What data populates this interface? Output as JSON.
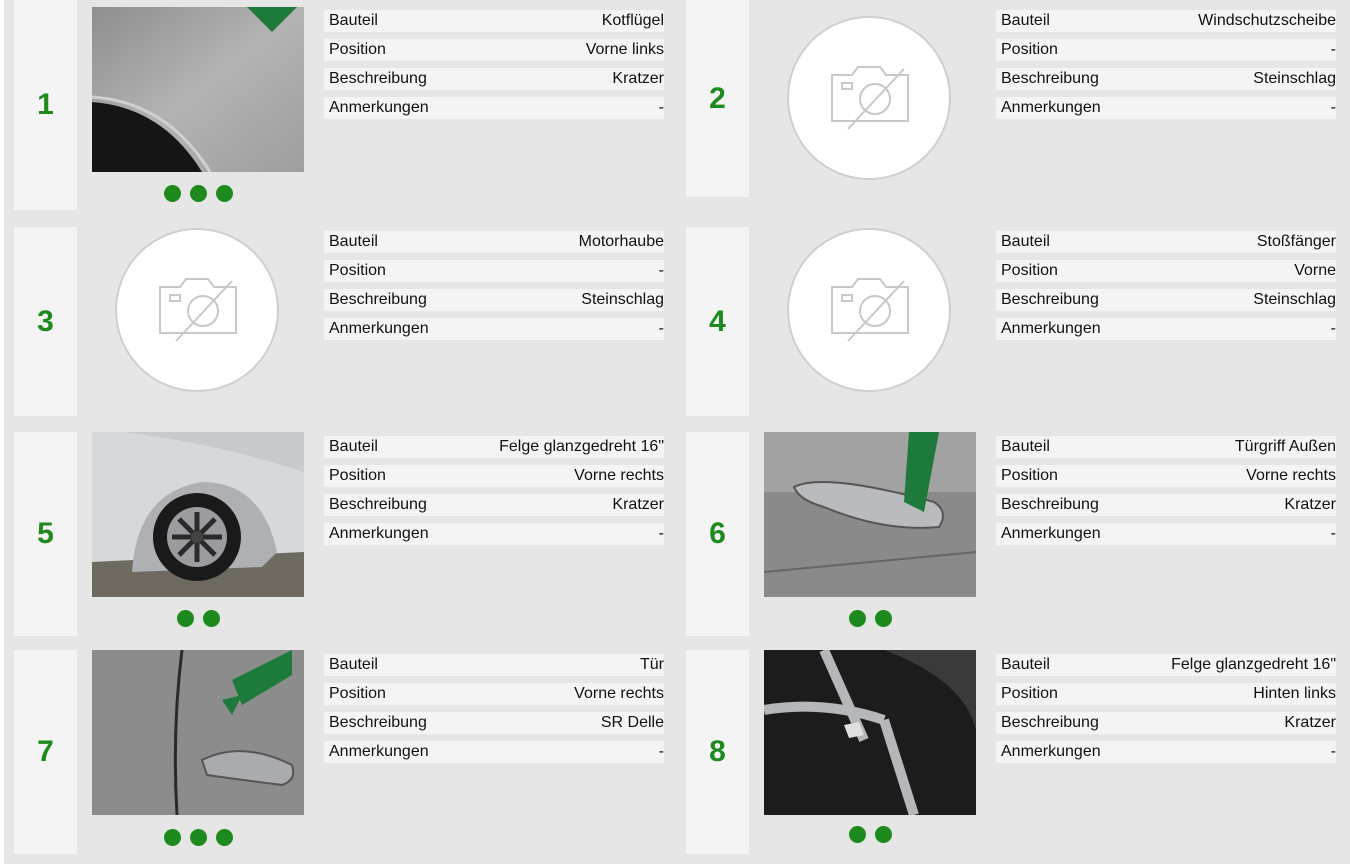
{
  "labels": {
    "component": "Bauteil",
    "position": "Position",
    "description": "Beschreibung",
    "remarks": "Anmerkungen"
  },
  "damages": [
    {
      "number": "1",
      "has_photo": true,
      "photo_dots": 3,
      "component": "Kotflügel",
      "position": "Vorne links",
      "description": "Kratzer",
      "remarks": "-"
    },
    {
      "number": "2",
      "has_photo": false,
      "photo_dots": 0,
      "component": "Windschutzscheibe",
      "position": "-",
      "description": "Steinschlag",
      "remarks": "-"
    },
    {
      "number": "3",
      "has_photo": false,
      "photo_dots": 0,
      "component": "Motorhaube",
      "position": "-",
      "description": "Steinschlag",
      "remarks": "-"
    },
    {
      "number": "4",
      "has_photo": false,
      "photo_dots": 0,
      "component": "Stoßfänger",
      "position": "Vorne",
      "description": "Steinschlag",
      "remarks": "-"
    },
    {
      "number": "5",
      "has_photo": true,
      "photo_dots": 2,
      "component": "Felge glanzgedreht 16\"",
      "position": "Vorne rechts",
      "description": "Kratzer",
      "remarks": "-"
    },
    {
      "number": "6",
      "has_photo": true,
      "photo_dots": 2,
      "component": "Türgriff Außen",
      "position": "Vorne rechts",
      "description": "Kratzer",
      "remarks": "-"
    },
    {
      "number": "7",
      "has_photo": true,
      "photo_dots": 3,
      "component": "Tür",
      "position": "Vorne rechts",
      "description": "SR Delle",
      "remarks": "-"
    },
    {
      "number": "8",
      "has_photo": true,
      "photo_dots": 2,
      "component": "Felge glanzgedreht 16\"",
      "position": "Hinten links",
      "description": "Kratzer",
      "remarks": "-"
    }
  ],
  "colors": {
    "accent": "#1d8a1d",
    "panel": "#e6e6e6",
    "cell": "#f4f4f4"
  }
}
